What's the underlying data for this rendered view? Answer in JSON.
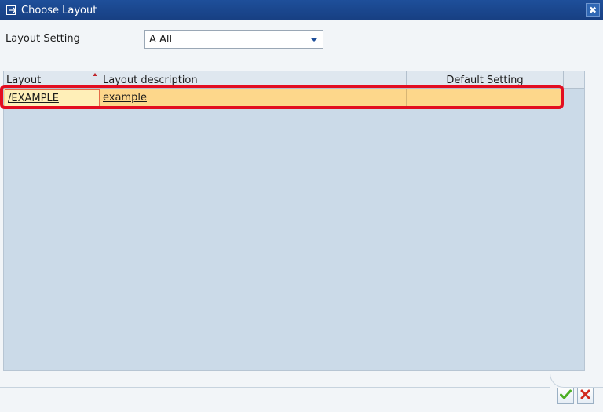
{
  "window": {
    "title": "Choose Layout",
    "close_glyph": "✖",
    "title_icon": "layout-dialog-icon"
  },
  "layout_setting": {
    "label": "Layout Setting",
    "value": "A All"
  },
  "grid": {
    "columns": [
      "Layout",
      "Layout description",
      "Default Setting"
    ],
    "sort_column": "Layout",
    "rows": [
      {
        "layout": "/EXAMPLE",
        "description": "example",
        "default": ""
      }
    ]
  },
  "buttons": {
    "ok_icon": "checkmark-icon",
    "cancel_icon": "cancel-x-icon"
  },
  "colors": {
    "titlebar": "#1e4f9a",
    "selected_row": "#fdd78b",
    "highlight_frame": "#e30d20",
    "ok_green": "#4caf24",
    "cancel_red": "#d22a1e"
  }
}
